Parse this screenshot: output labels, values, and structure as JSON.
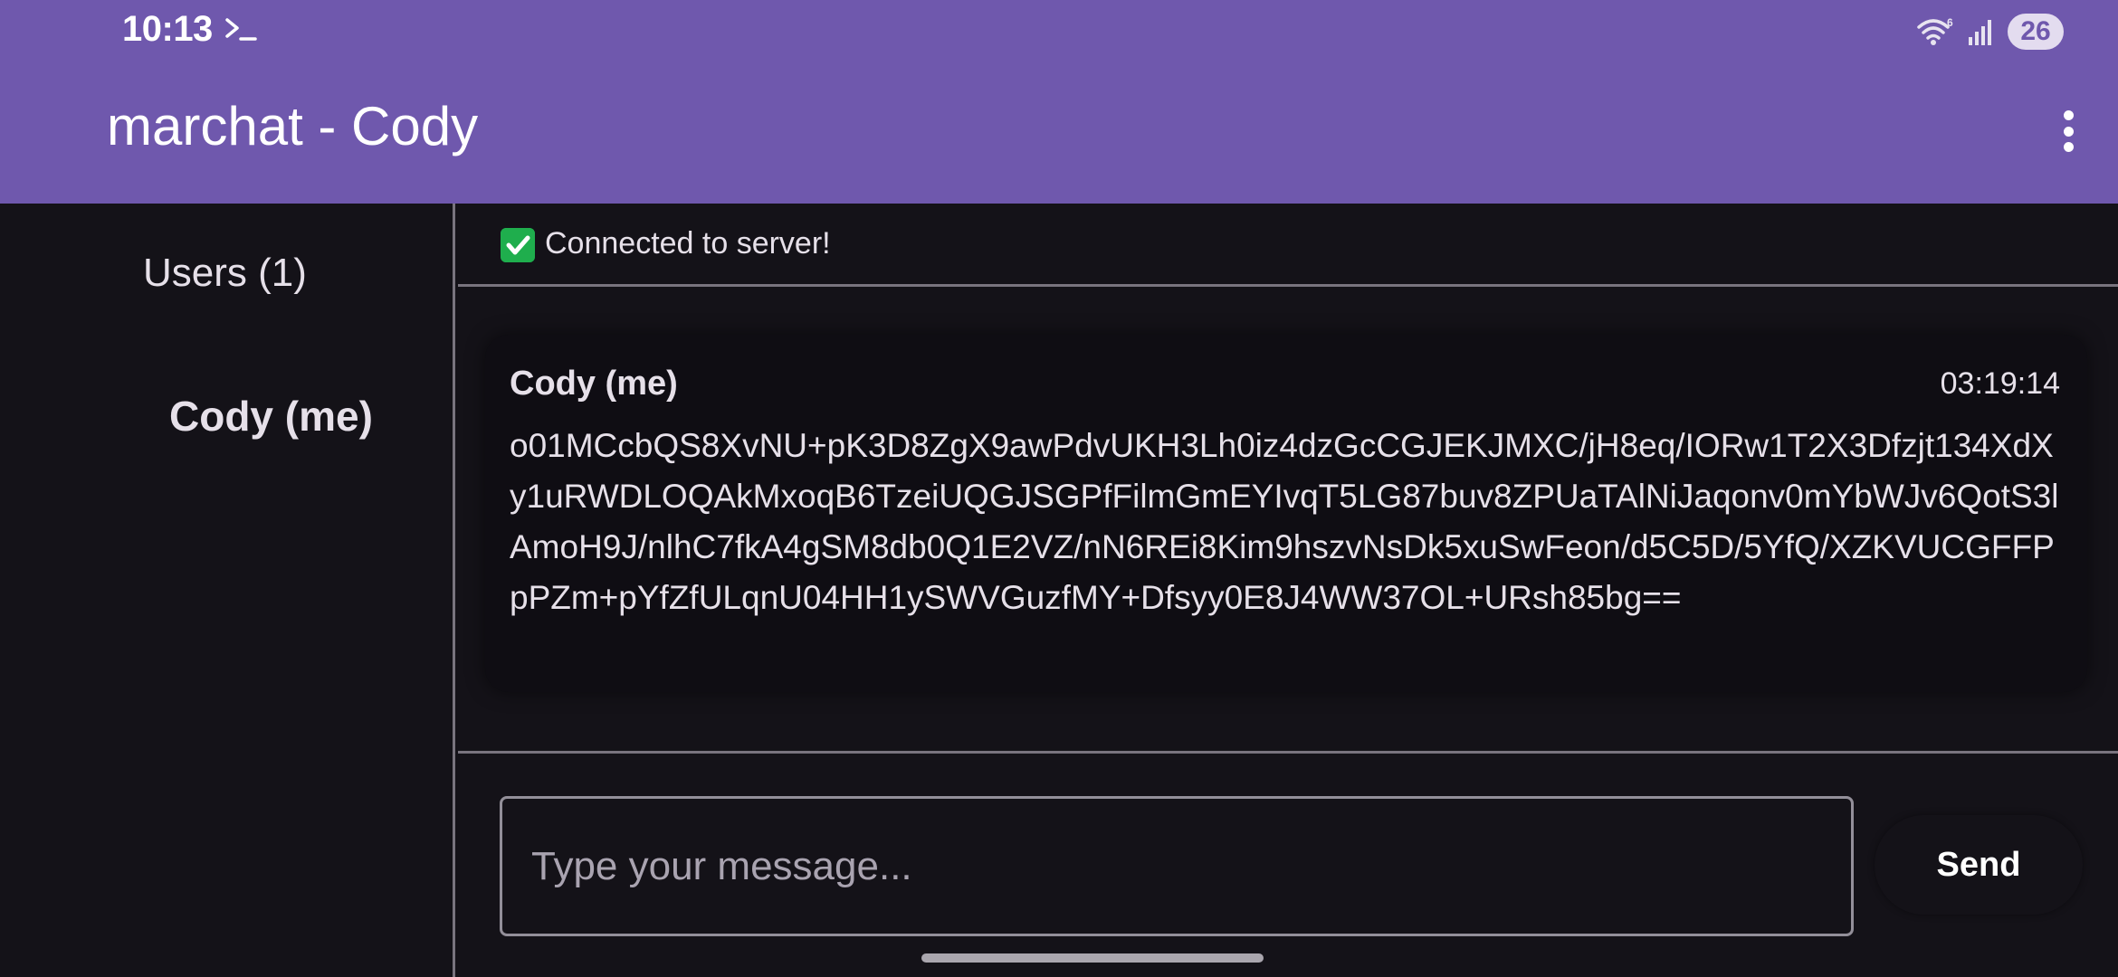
{
  "status_bar": {
    "time": "10:13",
    "terminal_icon": "terminal-prompt-icon",
    "wifi_icon": "wifi-6-icon",
    "signal_icon": "cell-signal-icon",
    "battery": "26"
  },
  "app_bar": {
    "title": "marchat - Cody",
    "menu_icon": "more-vert-icon"
  },
  "sidebar": {
    "heading": "Users (1)",
    "users": [
      {
        "label": "Cody (me)"
      }
    ]
  },
  "connection": {
    "icon": "check-box-icon",
    "text": "Connected to server!"
  },
  "messages": [
    {
      "sender": "Cody (me)",
      "time": "03:19:14",
      "body": "o01MCcbQS8XvNU+pK3D8ZgX9awPdvUKH3Lh0iz4dzGcCGJEKJMXC/jH8eq/IORw1T2X3Dfzjt134XdXy1uRWDLOQAkMxoqB6TzeiUQGJSGPfFilmGmEYIvqT5LG87buv8ZPUaTAlNiJaqonv0mYbWJv6QotS3lAmoH9J/nlhC7fkA4gSM8db0Q1E2VZ/nN6REi8Kim9hszvNsDk5xuSwFeon/d5C5D/5YfQ/XZKVUCGFFPpPZm+pYfZfULqnU04HH1ySWVGuzfMY+Dfsyy0E8J4WW37OL+URsh85bg=="
    }
  ],
  "composer": {
    "placeholder": "Type your message...",
    "send_label": "Send"
  },
  "colors": {
    "app_bar": "#6f58ad",
    "background": "#141218",
    "check_green": "#1fae4d"
  }
}
